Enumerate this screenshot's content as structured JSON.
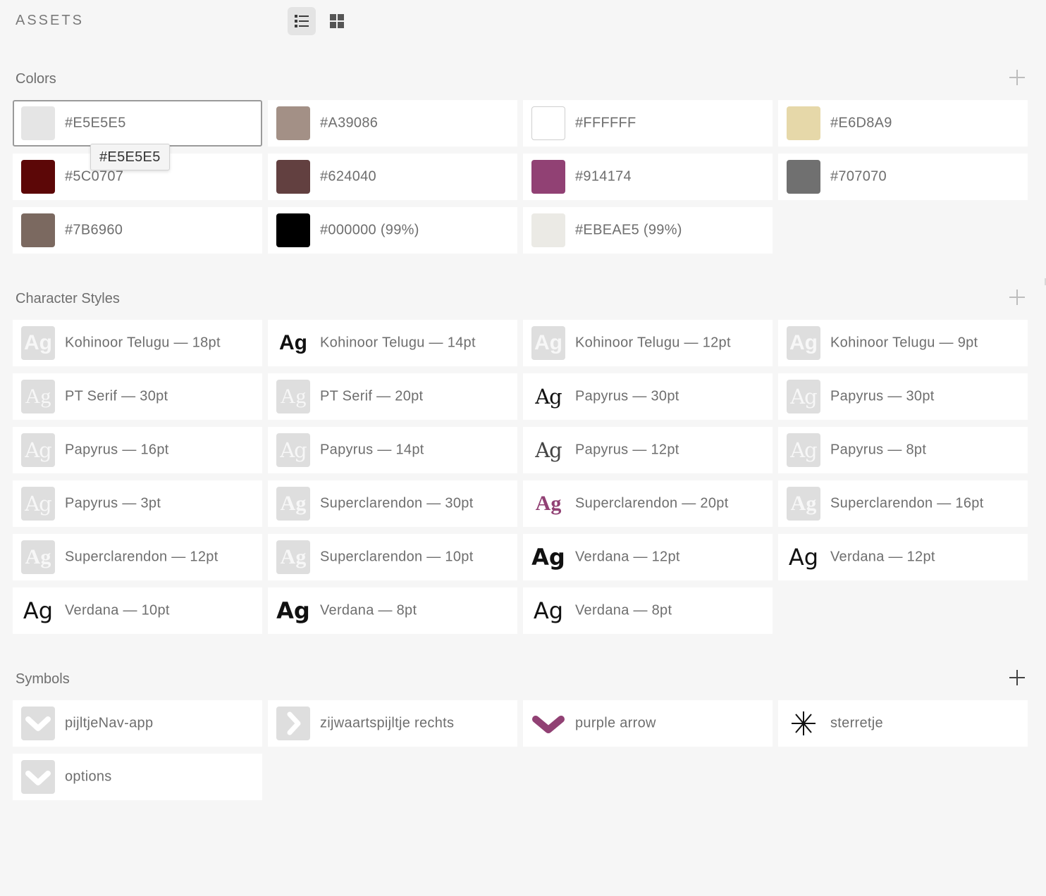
{
  "panel": {
    "title": "ASSETS"
  },
  "sections": {
    "colors": {
      "title": "Colors"
    },
    "character_styles": {
      "title": "Character Styles"
    },
    "symbols": {
      "title": "Symbols"
    }
  },
  "colors": [
    {
      "hex": "#E5E5E5",
      "label": "#E5E5E5"
    },
    {
      "hex": "#A39086",
      "label": "#A39086"
    },
    {
      "hex": "#FFFFFF",
      "label": "#FFFFFF"
    },
    {
      "hex": "#E6D8A9",
      "label": "#E6D8A9"
    },
    {
      "hex": "#5C0707",
      "label": "#5C0707"
    },
    {
      "hex": "#624040",
      "label": "#624040"
    },
    {
      "hex": "#914174",
      "label": "#914174"
    },
    {
      "hex": "#707070",
      "label": "#707070"
    },
    {
      "hex": "#7B6960",
      "label": "#7B6960"
    },
    {
      "hex": "#000000",
      "label": "#000000 (99%)"
    },
    {
      "hex": "#EBEAE5",
      "label": "#EBEAE5 (99%)"
    }
  ],
  "tooltip": {
    "text": "#E5E5E5"
  },
  "char_styles": [
    {
      "preview": "Ag",
      "label": "Kohinoor Telugu — 18pt"
    },
    {
      "preview": "Ag",
      "label": "Kohinoor Telugu — 14pt"
    },
    {
      "preview": "Ag",
      "label": "Kohinoor Telugu — 12pt"
    },
    {
      "preview": "Ag",
      "label": "Kohinoor Telugu — 9pt"
    },
    {
      "preview": "Ag",
      "label": "PT Serif — 30pt"
    },
    {
      "preview": "Ag",
      "label": "PT Serif — 20pt"
    },
    {
      "preview": "Ag",
      "label": "Papyrus — 30pt"
    },
    {
      "preview": "Ag",
      "label": "Papyrus — 30pt"
    },
    {
      "preview": "Ag",
      "label": "Papyrus — 16pt"
    },
    {
      "preview": "Ag",
      "label": "Papyrus — 14pt"
    },
    {
      "preview": "Ag",
      "label": "Papyrus — 12pt"
    },
    {
      "preview": "Ag",
      "label": "Papyrus — 8pt"
    },
    {
      "preview": "Ag",
      "label": "Papyrus — 3pt"
    },
    {
      "preview": "Ag",
      "label": "Superclarendon — 30pt"
    },
    {
      "preview": "Ag",
      "label": "Superclarendon — 20pt"
    },
    {
      "preview": "Ag",
      "label": "Superclarendon — 16pt"
    },
    {
      "preview": "Ag",
      "label": "Superclarendon — 12pt"
    },
    {
      "preview": "Ag",
      "label": "Superclarendon — 10pt"
    },
    {
      "preview": "Ag",
      "label": "Verdana — 12pt"
    },
    {
      "preview": "Ag",
      "label": "Verdana — 12pt"
    },
    {
      "preview": "Ag",
      "label": "Verdana — 10pt"
    },
    {
      "preview": "Ag",
      "label": "Verdana — 8pt"
    },
    {
      "preview": "Ag",
      "label": "Verdana — 8pt"
    }
  ],
  "symbols": [
    {
      "label": "pijltjeNav-app",
      "icon": "chevron-down-icon"
    },
    {
      "label": "zijwaartspijltje rechts",
      "icon": "chevron-right-icon"
    },
    {
      "label": "purple arrow",
      "icon": "purple-heart-chevron-icon",
      "color": "#914174"
    },
    {
      "label": "sterretje",
      "icon": "asterisk-icon"
    },
    {
      "label": "options",
      "icon": "chevron-down-icon"
    }
  ]
}
